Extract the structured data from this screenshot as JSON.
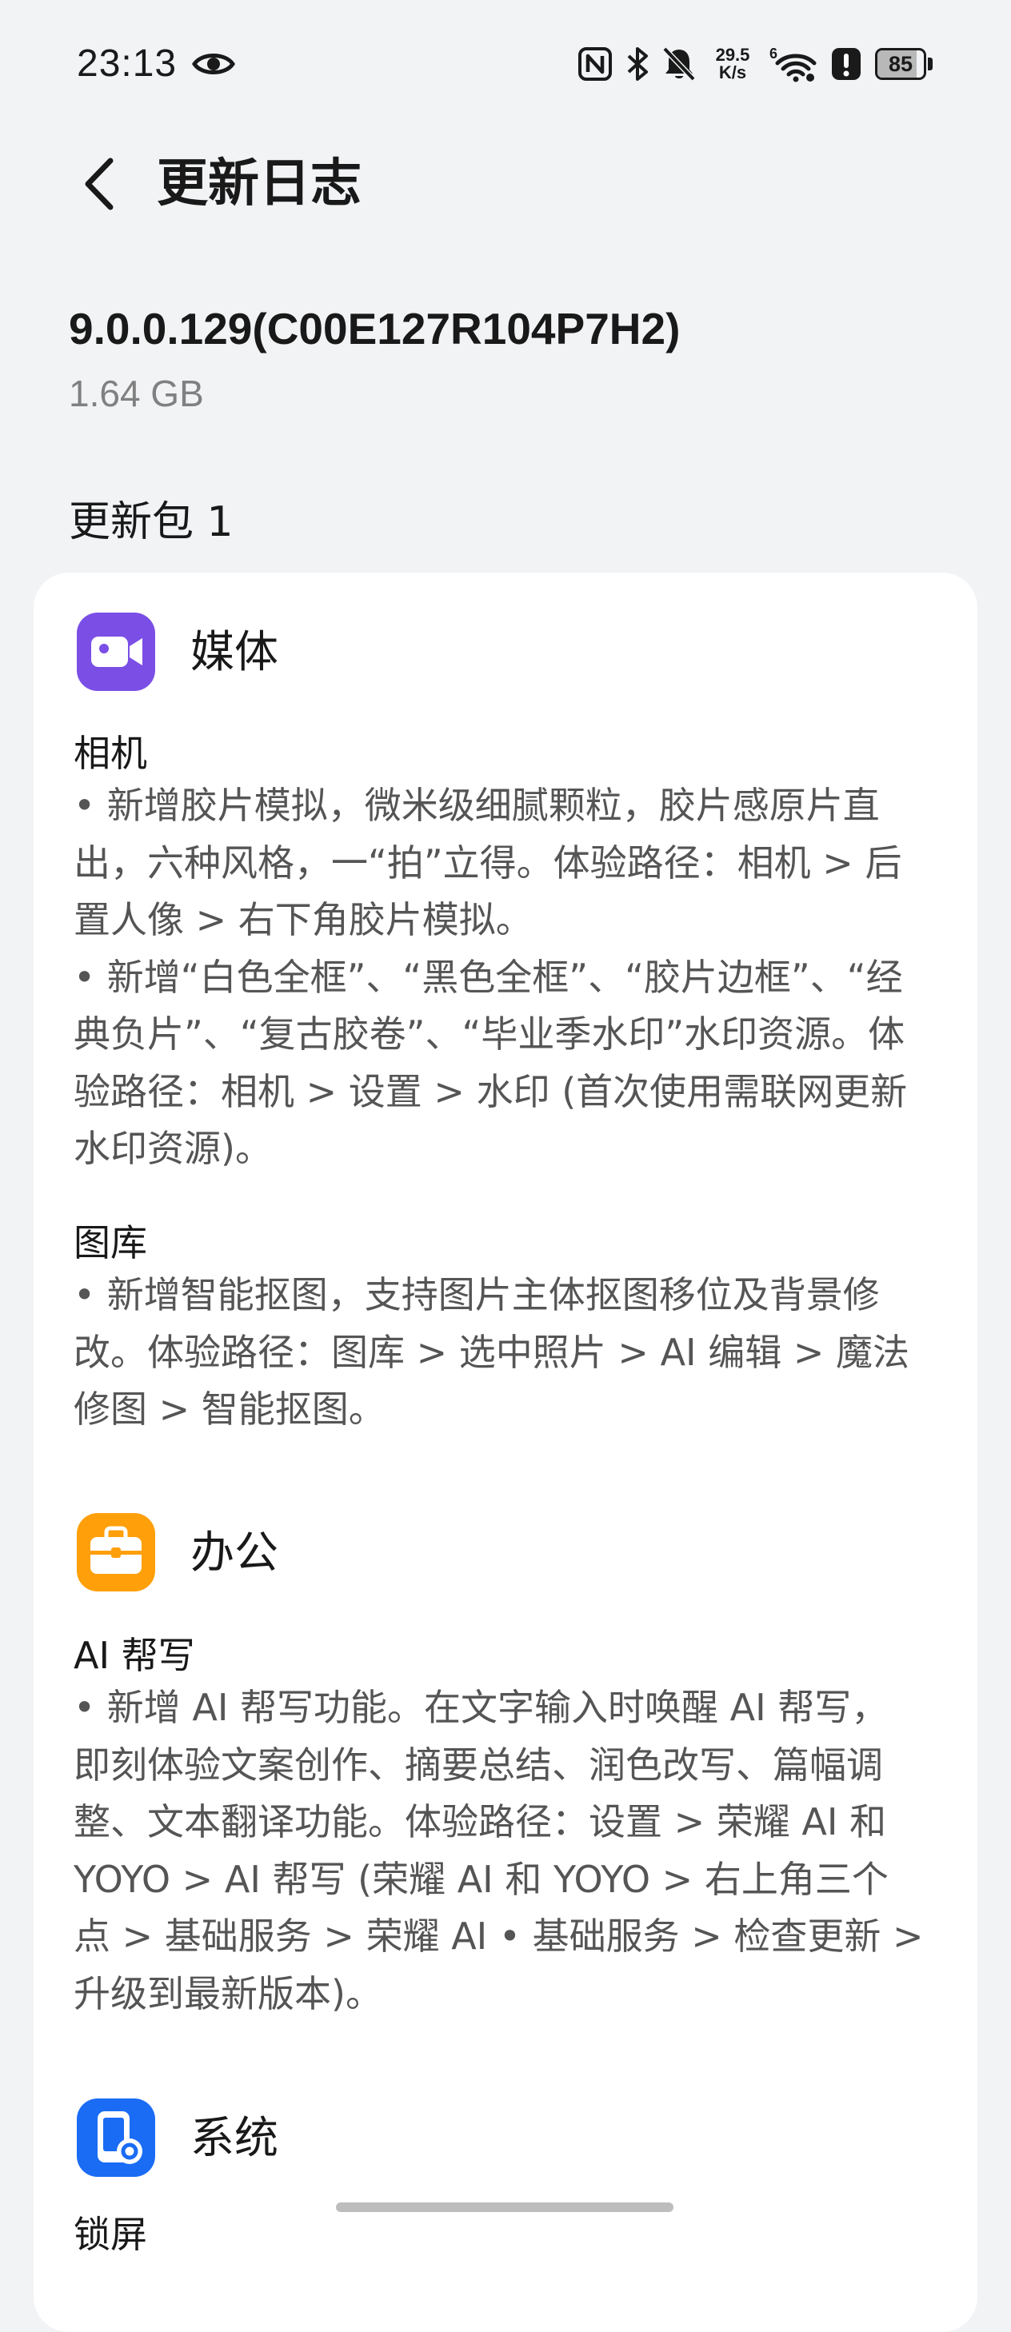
{
  "status_bar": {
    "time": "23:13",
    "net_speed_value": "29.5",
    "net_speed_unit": "K/s",
    "battery_level": "85",
    "icons": [
      "eye-icon",
      "nfc-icon",
      "bluetooth-icon",
      "bell-off-icon",
      "wifi-6-icon",
      "alert-icon",
      "battery-icon"
    ]
  },
  "header": {
    "title": "更新日志",
    "back_icon": "chevron-left-icon"
  },
  "version": {
    "number": "9.0.0.129(C00E127R104P7H2)",
    "size": "1.64 GB"
  },
  "package": {
    "title": "更新包 1"
  },
  "sections": [
    {
      "title": "媒体",
      "icon": "video-camera-icon",
      "icon_color": "#7b4ee6",
      "groups": [
        {
          "title": "相机",
          "lines": [
            "• 新增胶片模拟，微米级细腻颗粒，胶片感原片直",
            "出，六种风格，一“拍”立得。体验路径：相机 > 后",
            "置人像 > 右下角胶片模拟。",
            "• 新增“白色全框”、“黑色全框”、“胶片边框”、“经",
            "典负片”、“复古胶卷”、“毕业季水印”水印资源。体",
            "验路径：相机 > 设置 > 水印 (首次使用需联网更新",
            "水印资源)。"
          ]
        },
        {
          "title": "图库",
          "lines": [
            "• 新增智能抠图，支持图片主体抠图移位及背景修",
            "改。体验路径：图库 > 选中照片 > AI 编辑 > 魔法",
            "修图 > 智能抠图。"
          ]
        }
      ]
    },
    {
      "title": "办公",
      "icon": "briefcase-icon",
      "icon_color": "#ff9f0a",
      "groups": [
        {
          "title": "AI 帮写",
          "lines": [
            "• 新增 AI 帮写功能。在文字输入时唤醒 AI 帮写，",
            "即刻体验文案创作、摘要总结、润色改写、篇幅调",
            "整、文本翻译功能。体验路径：设置 > 荣耀 AI 和",
            "YOYO > AI 帮写 (荣耀 AI 和 YOYO > 右上角三个",
            "点 > 基础服务 > 荣耀 AI • 基础服务 > 检查更新 >",
            "升级到最新版本)。"
          ]
        }
      ]
    },
    {
      "title": "系统",
      "icon": "phone-settings-icon",
      "icon_color": "#1a6cf5",
      "groups": [
        {
          "title": "锁屏",
          "lines": []
        }
      ]
    }
  ]
}
